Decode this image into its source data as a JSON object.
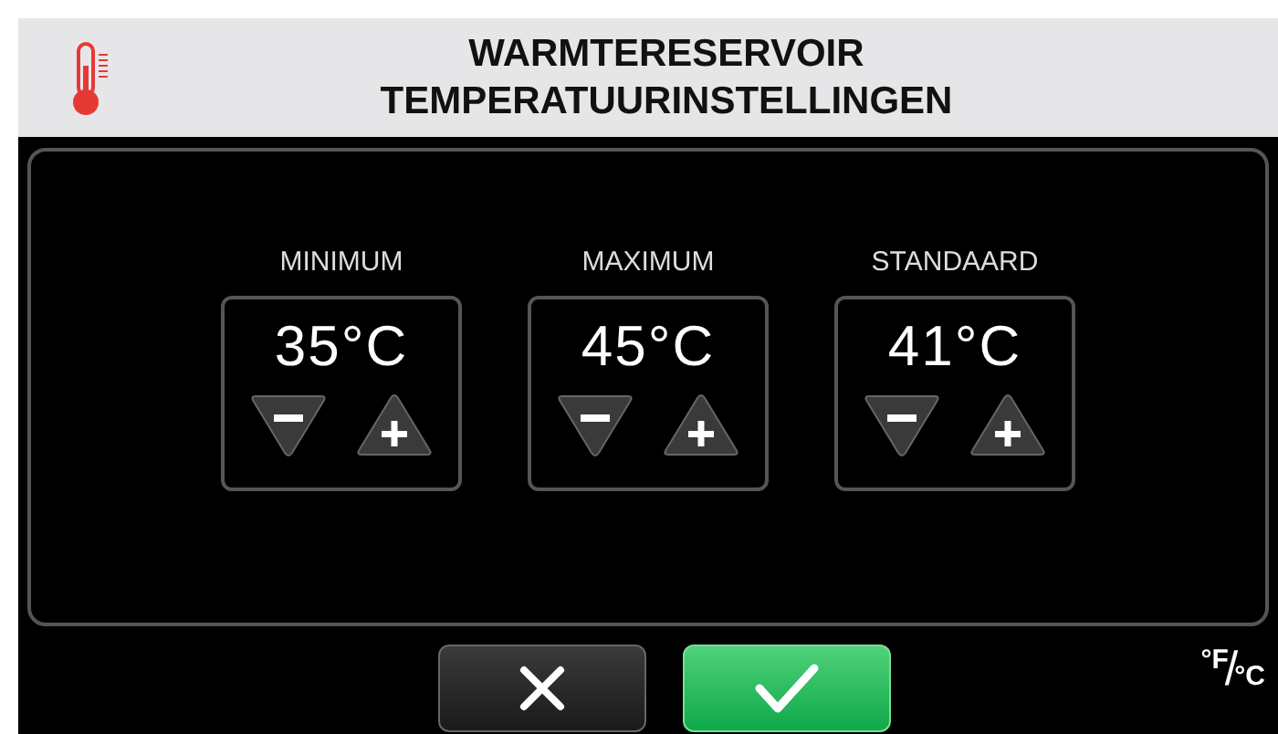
{
  "header": {
    "title_lines": [
      "WARMTERESERVOIR",
      "TEMPERATUURINSTELLINGEN"
    ]
  },
  "settings": [
    {
      "label": "MINIMUM",
      "value": "35°C"
    },
    {
      "label": "MAXIMUM",
      "value": "45°C"
    },
    {
      "label": "STANDAARD",
      "value": "41°C"
    }
  ],
  "buttons": [
    {
      "kind": "cancel"
    },
    {
      "kind": "confirm"
    }
  ],
  "unit_toggle": {
    "upper": "°F",
    "separator": "/",
    "lower": "°C"
  }
}
